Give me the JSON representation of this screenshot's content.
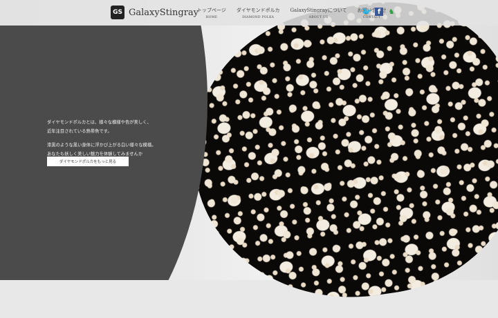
{
  "header": {
    "logo_text": "GalaxyStingray",
    "logo_mark": "GS",
    "nav": [
      {
        "jp": "トップページ",
        "en": "HOME"
      },
      {
        "jp": "ダイヤモンドポルカ",
        "en": "DIAMOND POLKA"
      },
      {
        "jp": "GalaxyStingrayについて",
        "en": "ABOUT US"
      },
      {
        "jp": "お問い合わせ",
        "en": "CONTACT"
      }
    ],
    "social": {
      "twitter": "twitter-icon",
      "facebook": "facebook-icon",
      "facebook_glyph": "f",
      "other": "mascot-icon"
    }
  },
  "hero": {
    "para1_line1": "ダイヤモンドポルカとは、様々な模様や色が美しく、",
    "para1_line2": "近年注目されている熱帯魚です。",
    "para2_line1": "漆黒のような黒い身体に浮かび上がる白い様々な模様。",
    "para2_line2": "あなたも妖しく美しい魅力を体験してみませんか",
    "button": "ダイヤモンドポルカをもっと見る"
  }
}
